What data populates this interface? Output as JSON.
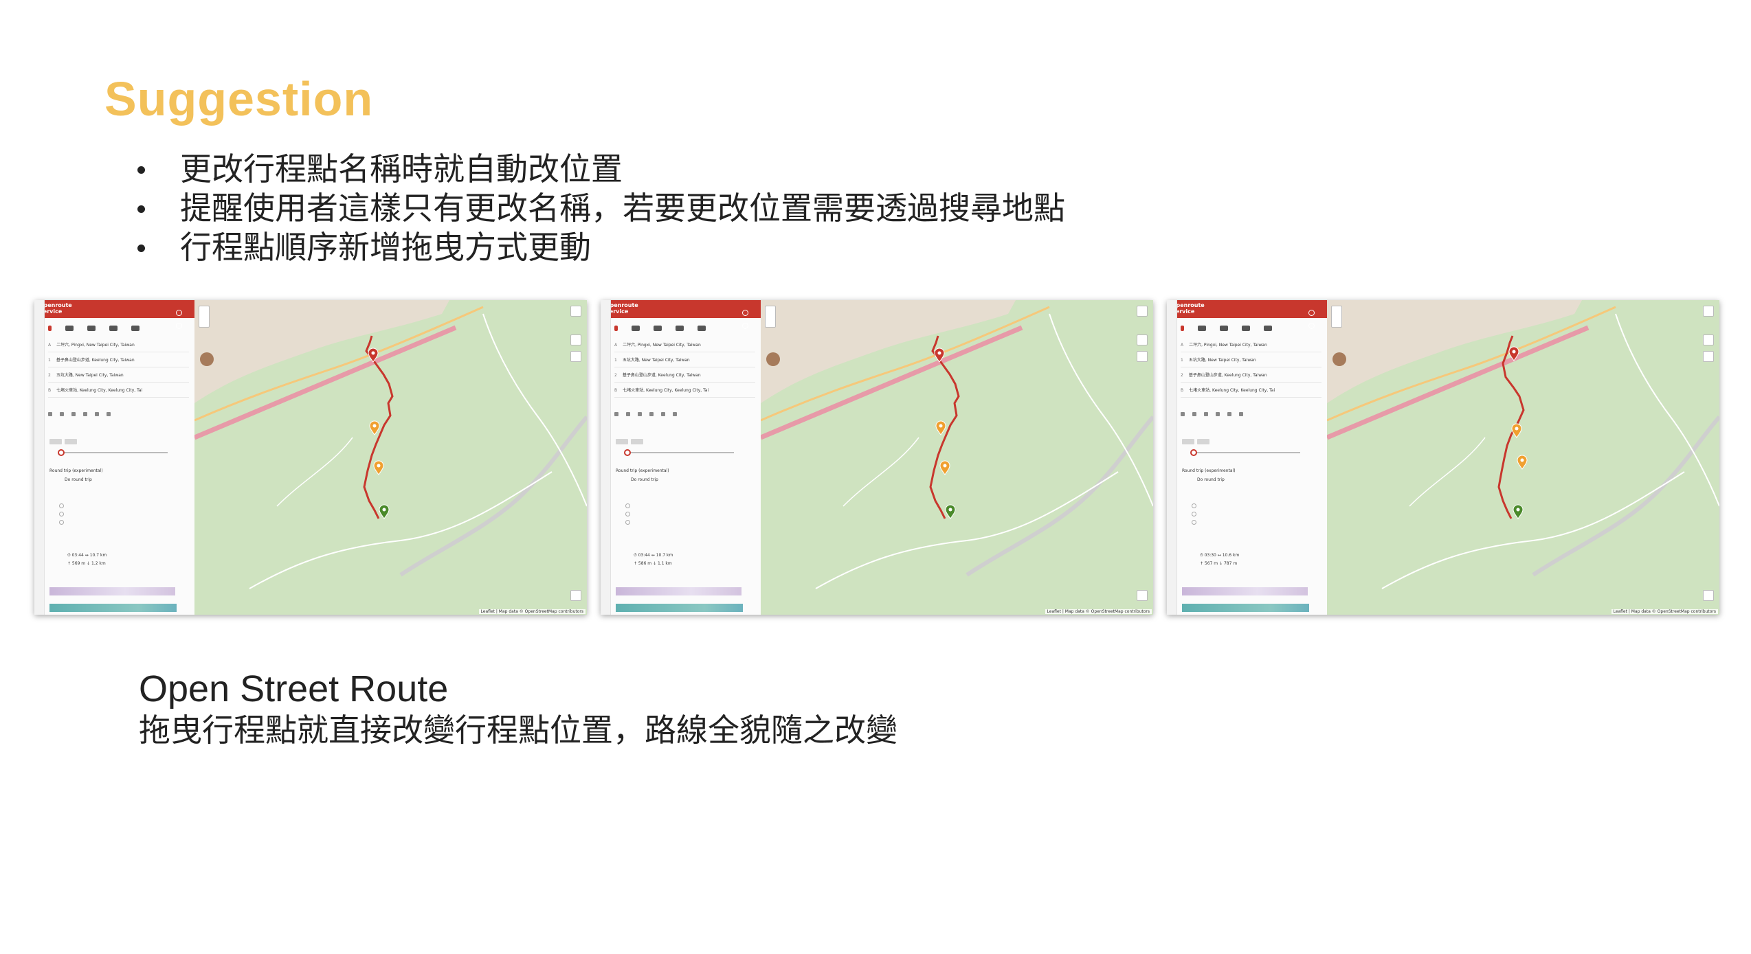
{
  "slide": {
    "title": "Suggestion",
    "bullets": [
      "更改行程點名稱時就自動改位置",
      "提醒使用者這樣只有更改名稱，若要更改位置需要透過搜尋地點",
      "行程點順序新增拖曳方式更動"
    ],
    "caption_title": "Open Street Route",
    "caption_text": "拖曳行程點就直接改變行程點位置，路線全貌隨之改變"
  },
  "colors": {
    "title": "#f3c15a",
    "brand_red": "#c8372d",
    "route": "#c8372d",
    "map_green": "#cfe3c0"
  },
  "screenshots": [
    {
      "brand": "openroute service",
      "waypoints": [
        {
          "tag": "A",
          "text": "二坪六, Pingxi, New Taipei City, Taiwan"
        },
        {
          "tag": "1",
          "text": "基子鼻山登山步道, Keelung City, Taiwan"
        },
        {
          "tag": "2",
          "text": "五坑大路, New Taipei City, Taiwan"
        },
        {
          "tag": "B",
          "text": "七堵火車站, Keelung City, Keelung City, Tai"
        }
      ],
      "round_trip": "Round trip (experimental)",
      "do_round_trip": "Do round trip",
      "stats": "⏱ 03:44 ↔ 10.7 km",
      "elev": "↑ 569 m ↓ 1.2 km",
      "attribution": "Leaflet | Map data © OpenStreetMap contributors"
    },
    {
      "brand": "openroute service",
      "waypoints": [
        {
          "tag": "A",
          "text": "二坪六, Pingxi, New Taipei City, Taiwan"
        },
        {
          "tag": "1",
          "text": "五坑大路, New Taipei City, Taiwan"
        },
        {
          "tag": "2",
          "text": "基子鼻山登山步道, Keelung City, Taiwan"
        },
        {
          "tag": "B",
          "text": "七堵火車站, Keelung City, Keelung City, Tai"
        }
      ],
      "round_trip": "Round trip (experimental)",
      "do_round_trip": "Do round trip",
      "stats": "⏱ 03:44 ↔ 10.7 km",
      "elev": "↑ 586 m ↓ 1.1 km",
      "attribution": "Leaflet | Map data © OpenStreetMap contributors"
    },
    {
      "brand": "openroute service",
      "waypoints": [
        {
          "tag": "A",
          "text": "二坪六, Pingxi, New Taipei City, Taiwan"
        },
        {
          "tag": "1",
          "text": "五坑大路, New Taipei City, Taiwan"
        },
        {
          "tag": "2",
          "text": "基子鼻山登山步道, Keelung City, Taiwan"
        },
        {
          "tag": "B",
          "text": "七堵火車站, Keelung City, Keelung City, Tai"
        }
      ],
      "round_trip": "Round trip (experimental)",
      "do_round_trip": "Do round trip",
      "stats": "⏱ 03:30 ↔ 10.6 km",
      "elev": "↑ 567 m ↓ 787 m",
      "attribution": "Leaflet | Map data © OpenStreetMap contributors"
    }
  ]
}
